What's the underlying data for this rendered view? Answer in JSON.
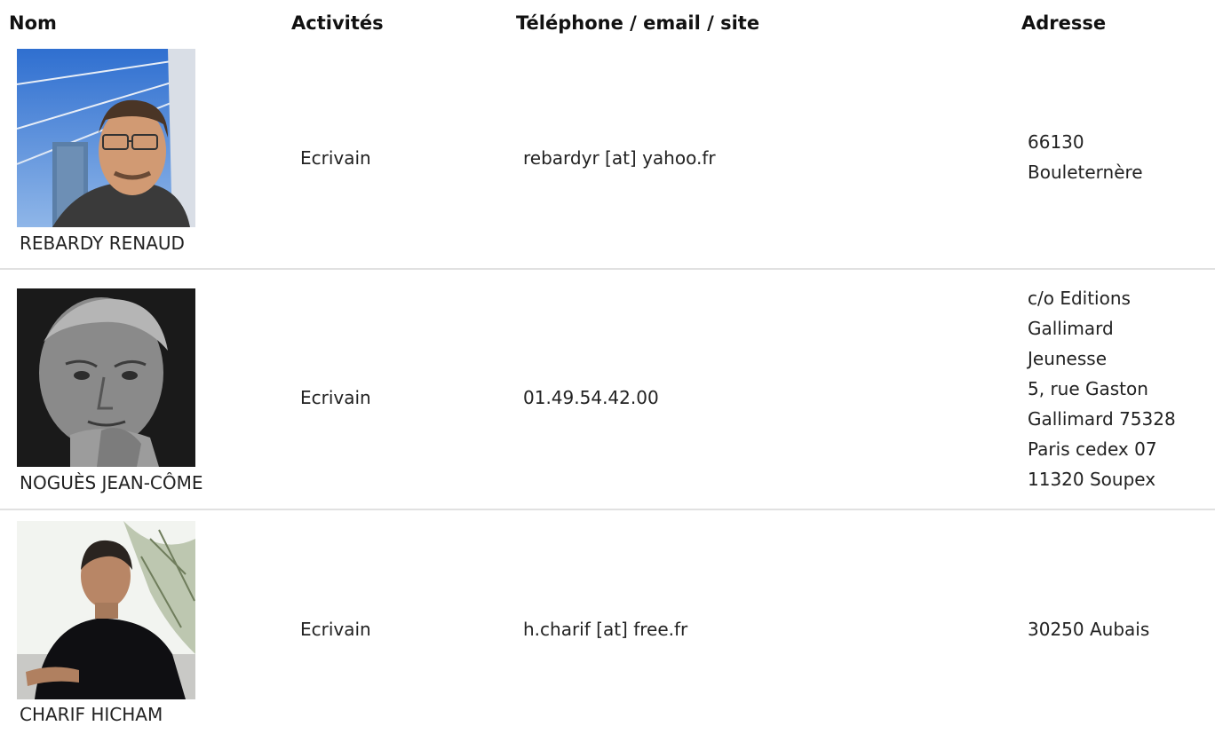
{
  "headers": {
    "nom": "Nom",
    "activites": "Activités",
    "contact": "Téléphone / email / site",
    "adresse": "Adresse"
  },
  "rows": [
    {
      "name": "REBARDY RENAUD",
      "activity": "Ecrivain",
      "contact": "rebardyr [at] yahoo.fr",
      "address": [
        "66130",
        "Bouleternère"
      ],
      "photo": "portrait-photo-man-with-glasses-blue-sky"
    },
    {
      "name": "NOGUÈS JEAN-CÔME",
      "activity": "Ecrivain",
      "contact": "01.49.54.42.00",
      "address": [
        "c/o Editions",
        "Gallimard",
        "Jeunesse",
        "5, rue Gaston",
        "Gallimard 75328",
        "Paris cedex 07",
        "11320 Soupex"
      ],
      "photo": "portrait-photo-black-and-white-older-man"
    },
    {
      "name": "CHARIF HICHAM",
      "activity": "Ecrivain",
      "contact": "h.charif [at] free.fr",
      "address": [
        "30250 Aubais"
      ],
      "photo": "portrait-photo-man-black-sweater-outdoors"
    }
  ]
}
